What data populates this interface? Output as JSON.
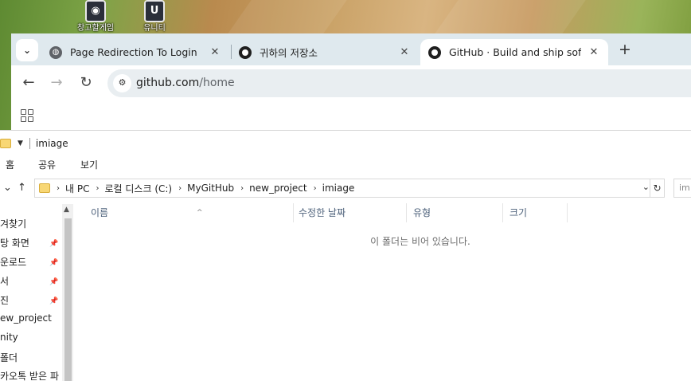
{
  "desktop": {
    "icons": [
      {
        "label": "창고할게임",
        "icon": "app-icon"
      },
      {
        "label": "유니티",
        "icon": "unity-icon"
      }
    ]
  },
  "browser": {
    "tab_search_icon": "chevron-down-icon",
    "tabs": [
      {
        "title": "Page Redirection To Login",
        "icon": "globe-icon",
        "active": false
      },
      {
        "title": "귀하의 저장소",
        "icon": "github-icon",
        "active": false
      },
      {
        "title": "GitHub · Build and ship software",
        "icon": "github-icon",
        "active": true
      }
    ],
    "close_glyph": "✕",
    "new_tab_glyph": "+",
    "url_host": "github.com",
    "url_path": "/home",
    "back_glyph": "←",
    "forward_glyph": "→",
    "reload_glyph": "↻"
  },
  "explorer": {
    "window_title": "imiage",
    "ribbon": [
      "홈",
      "공유",
      "보기"
    ],
    "breadcrumbs": [
      "내 PC",
      "로컬 디스크 (C:)",
      "MyGitHub",
      "new_project",
      "imiage"
    ],
    "search_placeholder": "im",
    "nav_items": [
      {
        "label": "겨찾기",
        "pinned": false
      },
      {
        "label": "탕 화면",
        "pinned": true
      },
      {
        "label": "운로드",
        "pinned": true
      },
      {
        "label": "서",
        "pinned": true
      },
      {
        "label": "진",
        "pinned": true
      },
      {
        "label": "ew_project",
        "pinned": false
      },
      {
        "label": "nity",
        "pinned": false
      },
      {
        "label": "폴더",
        "pinned": false
      },
      {
        "label": "카오톡 받은 파",
        "pinned": false
      }
    ],
    "columns": [
      "이름",
      "수정한 날짜",
      "유형",
      "크기"
    ],
    "empty_message": "이 폴더는 비어 있습니다."
  },
  "colors": {
    "chrome_frame": "#dfe9ee",
    "omnibox": "#e9eef1",
    "column_header_text": "#4c607a"
  }
}
